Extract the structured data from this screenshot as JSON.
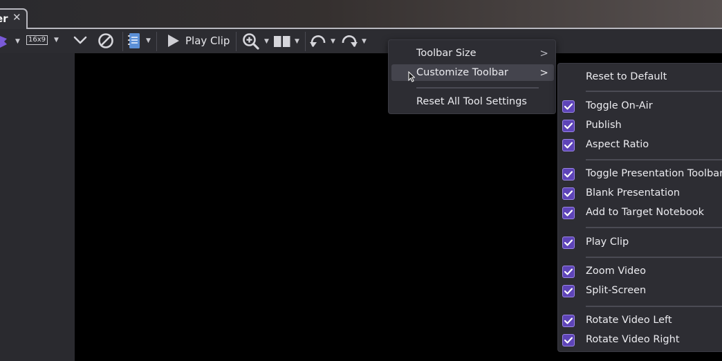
{
  "tab": {
    "title": "er",
    "close_glyph": "✕"
  },
  "toolbar": {
    "aspect_ratio": "16x9",
    "play_clip_label": "Play Clip",
    "icons": [
      "logo-icon",
      "chevron-down-icon",
      "blank-icon",
      "notebook-icon",
      "play-icon",
      "zoom-in-icon",
      "split-screen-icon",
      "rotate-left-icon",
      "rotate-right-icon"
    ]
  },
  "context_menu": {
    "items": [
      {
        "label": "Toolbar Size",
        "has_submenu": true
      },
      {
        "label": "Customize Toolbar",
        "has_submenu": true,
        "highlighted": true
      },
      {
        "label": "Reset All Tool Settings",
        "has_submenu": false
      }
    ]
  },
  "submenu": {
    "reset_label": "Reset to Default",
    "groups": [
      [
        {
          "label": "Toggle On-Air",
          "checked": true
        },
        {
          "label": "Publish",
          "checked": true
        },
        {
          "label": "Aspect Ratio",
          "checked": true
        }
      ],
      [
        {
          "label": "Toggle Presentation Toolbar",
          "checked": true
        },
        {
          "label": "Blank Presentation",
          "checked": true
        },
        {
          "label": "Add to Target Notebook",
          "checked": true
        }
      ],
      [
        {
          "label": "Play Clip",
          "checked": true
        }
      ],
      [
        {
          "label": "Zoom Video",
          "checked": true
        },
        {
          "label": "Split-Screen",
          "checked": true
        }
      ],
      [
        {
          "label": "Rotate Video Left",
          "checked": true
        },
        {
          "label": "Rotate Video Right",
          "checked": true
        }
      ]
    ]
  },
  "colors": {
    "accent": "#5e44b8",
    "menu_bg": "#2d2d33",
    "canvas": "#000000"
  }
}
